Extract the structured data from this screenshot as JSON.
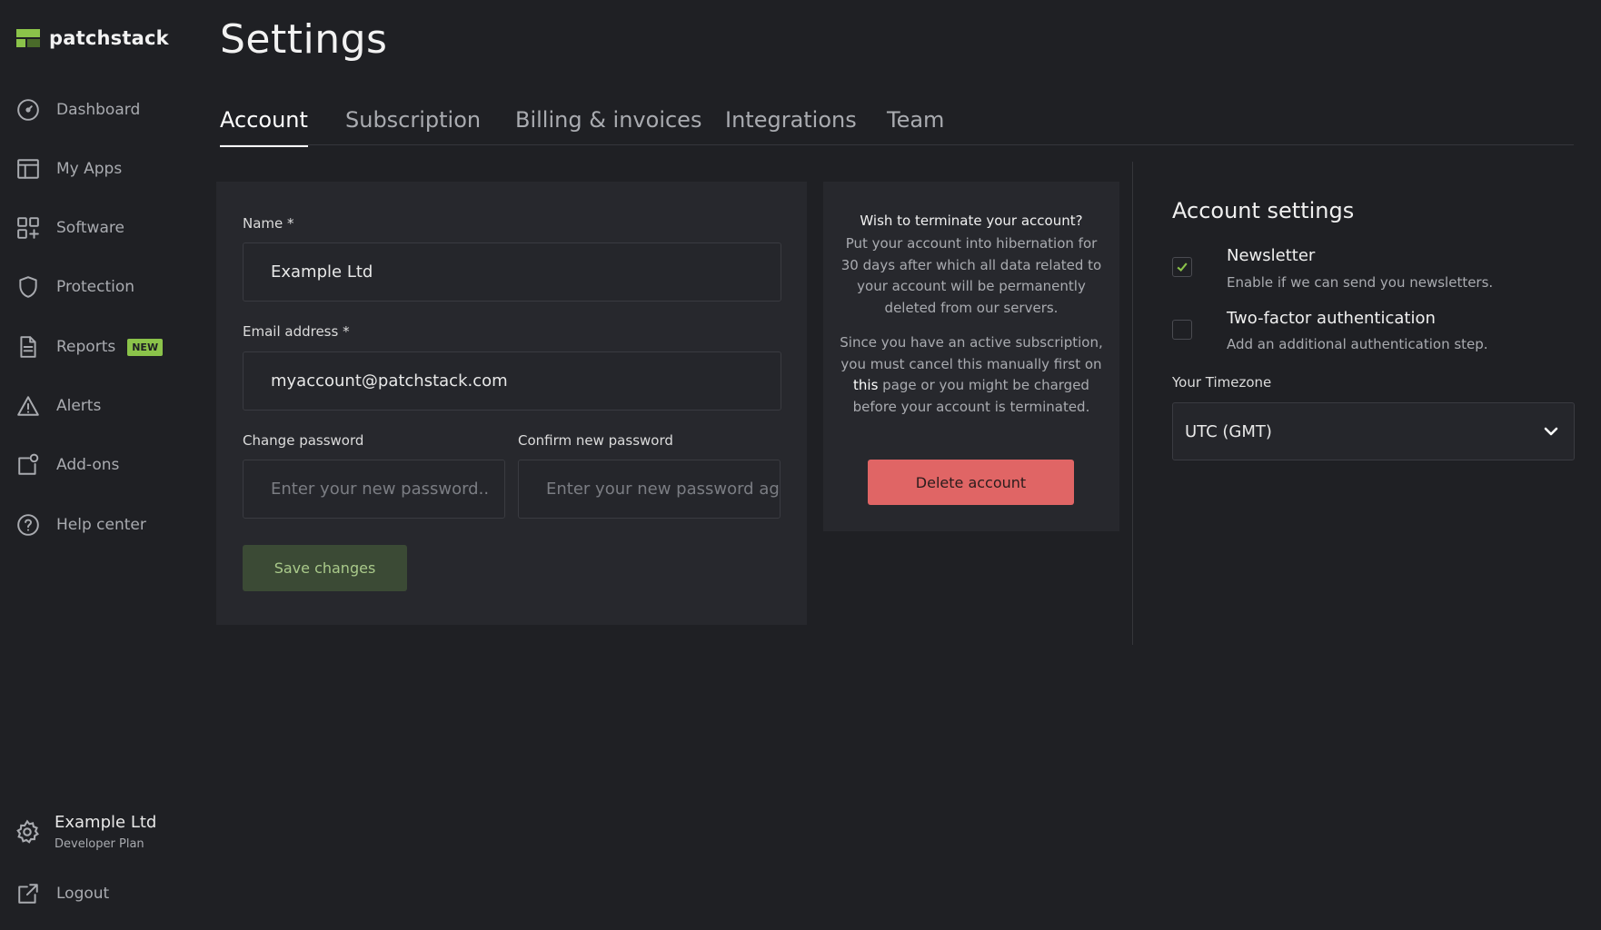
{
  "brand": {
    "name": "patchstack"
  },
  "sidebar": {
    "items": [
      {
        "label": "Dashboard",
        "icon": "dashboard-gauge-icon"
      },
      {
        "label": "My Apps",
        "icon": "layout-icon"
      },
      {
        "label": "Software",
        "icon": "grid-plus-icon"
      },
      {
        "label": "Protection",
        "icon": "shield-icon"
      },
      {
        "label": "Reports",
        "icon": "document-icon",
        "badge": "NEW"
      },
      {
        "label": "Alerts",
        "icon": "warning-triangle-icon"
      },
      {
        "label": "Add-ons",
        "icon": "addon-icon"
      },
      {
        "label": "Help center",
        "icon": "question-circle-icon"
      }
    ],
    "account": {
      "name": "Example Ltd",
      "plan": "Developer Plan"
    },
    "logout_label": "Logout"
  },
  "page": {
    "title": "Settings"
  },
  "tabs": [
    {
      "label": "Account",
      "active": true
    },
    {
      "label": "Subscription"
    },
    {
      "label": "Billing & invoices"
    },
    {
      "label": "Integrations"
    },
    {
      "label": "Team"
    }
  ],
  "form": {
    "name_label": "Name *",
    "name_value": "Example Ltd",
    "email_label": "Email address *",
    "email_value": "myaccount@patchstack.com",
    "password_label": "Change password",
    "password_placeholder": "Enter your new password..",
    "confirm_label": "Confirm new password",
    "confirm_placeholder": "Enter your new password ag",
    "save_label": "Save changes"
  },
  "terminate": {
    "question": "Wish to terminate your account?",
    "para1": "Put your account into hibernation for 30 days after which all data related to your account will be permanently deleted from our servers.",
    "para2_before": "Since you have an active subscription, you must cancel this manually first on ",
    "para2_link": "this",
    "para2_after": " page or you might be charged before your account is terminated.",
    "delete_label": "Delete account"
  },
  "account_settings": {
    "title": "Account settings",
    "newsletter_title": "Newsletter",
    "newsletter_desc": "Enable if we can send you newsletters.",
    "newsletter_checked": true,
    "twofa_title": "Two-factor authentication",
    "twofa_desc": "Add an additional authentication step.",
    "twofa_checked": false,
    "timezone_label": "Your Timezone",
    "timezone_value": "UTC (GMT)"
  },
  "colors": {
    "accent": "#8bc34a",
    "danger": "#e06565",
    "background": "#1f2024",
    "card": "#27282d"
  }
}
